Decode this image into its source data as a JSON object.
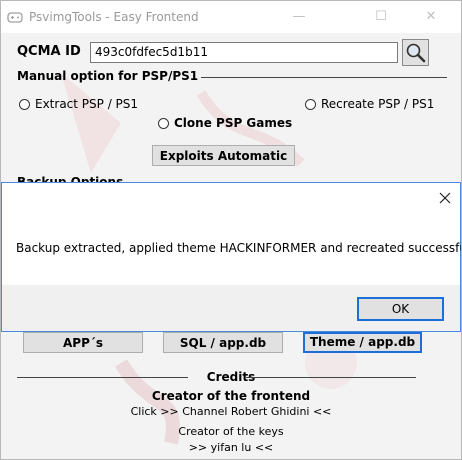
{
  "window": {
    "title": "PsvimgTools - Easy Frontend"
  },
  "qcma": {
    "label": "QCMA ID",
    "value": "493c0fdfec5d1b11"
  },
  "manual": {
    "title": "Manual option for PSP/PS1",
    "extract": "Extract PSP / PS1",
    "recreate": "Recreate PSP / PS1",
    "clone": "Clone PSP Games",
    "exploits": "Exploits Automatic"
  },
  "backup": {
    "title": "Backup Options"
  },
  "buttons": {
    "apps": "APP´s",
    "sql": "SQL / app.db",
    "theme": "Theme / app.db"
  },
  "credits": {
    "title": "Credits",
    "creator_frontend": "Creator of the frontend",
    "frontend_link": "Click >> Channel Robert Ghidini <<",
    "creator_keys": "Creator of the keys",
    "keys_author": ">> yifan lu <<"
  },
  "dialog": {
    "message": "Backup extracted, applied theme HACKINFORMER and recreated successfully!",
    "ok": "OK"
  },
  "icons": [
    "app-icon",
    "minimize-icon",
    "maximize-icon",
    "close-icon",
    "search-icon",
    "dialog-close-icon"
  ]
}
